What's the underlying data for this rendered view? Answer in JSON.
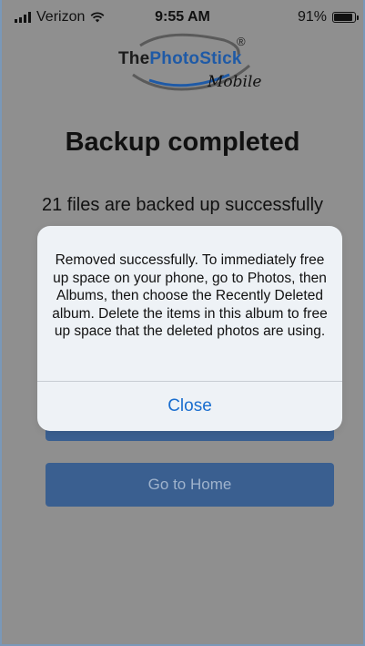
{
  "status_bar": {
    "carrier": "Verizon",
    "time": "9:55 AM",
    "battery": "91%"
  },
  "logo": {
    "brand_part1": "The",
    "brand_part2": "PhotoStick",
    "registered": "®",
    "tagline": "Mobile"
  },
  "main": {
    "title": "Backup completed",
    "subtitle": "21 files are backed up successfully",
    "home_button": "Go to Home"
  },
  "alert": {
    "message": "Removed successfully.  To immediately free up space on your phone, go to Photos, then Albums, then choose the Recently Deleted album.  Delete the items in this album to free up space that the deleted photos are using.",
    "close_label": "Close"
  },
  "colors": {
    "accent": "#1a6ecf",
    "button": "#3a5f90",
    "overlay": "#8f8f8f"
  }
}
